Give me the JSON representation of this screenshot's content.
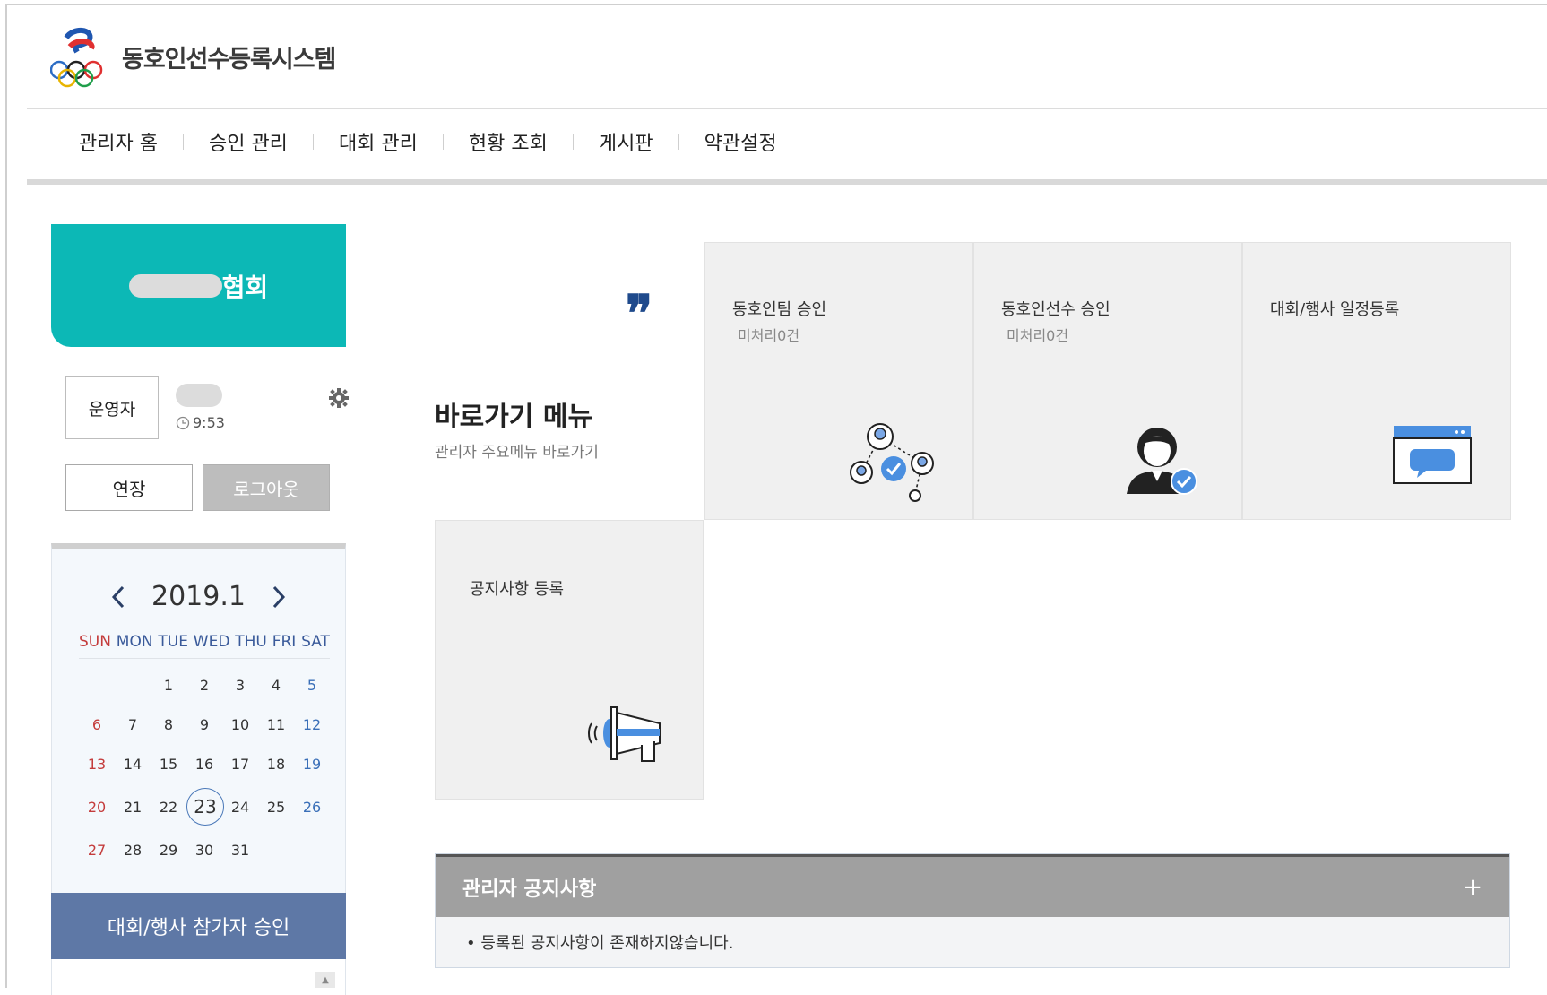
{
  "header": {
    "title": "동호인선수등록시스템"
  },
  "nav": {
    "items": [
      {
        "label": "관리자 홈"
      },
      {
        "label": "승인 관리"
      },
      {
        "label": "대회 관리"
      },
      {
        "label": "현황 조회"
      },
      {
        "label": "게시판"
      },
      {
        "label": "약관설정"
      }
    ]
  },
  "sidebar": {
    "assoc_suffix": "협회",
    "role": "운영자",
    "time": "9:53",
    "extend_label": "연장",
    "logout_label": "로그아웃",
    "calendar": {
      "title": "2019.1",
      "dow": [
        "SUN",
        "MON",
        "TUE",
        "WED",
        "THU",
        "FRI",
        "SAT"
      ],
      "weeks": [
        [
          "",
          "",
          "1",
          "2",
          "3",
          "4",
          "5"
        ],
        [
          "6",
          "7",
          "8",
          "9",
          "10",
          "11",
          "12"
        ],
        [
          "13",
          "14",
          "15",
          "16",
          "17",
          "18",
          "19"
        ],
        [
          "20",
          "21",
          "22",
          "23",
          "24",
          "25",
          "26"
        ],
        [
          "27",
          "28",
          "29",
          "30",
          "31",
          "",
          ""
        ]
      ],
      "today": "23"
    },
    "approve_label": "대회/행사 참가자 승인"
  },
  "shortcuts": {
    "quote": "❞",
    "title": "바로가기 메뉴",
    "subtitle": "관리자 주요메뉴 바로가기",
    "cards": [
      {
        "title": "동호인팀 승인",
        "count": "미처리0건",
        "icon": "network-check-icon"
      },
      {
        "title": "동호인선수 승인",
        "count": "미처리0건",
        "icon": "person-check-icon"
      },
      {
        "title": "대회/행사 일정등록",
        "count": "",
        "icon": "window-chat-icon"
      },
      {
        "title": "공지사항 등록",
        "count": "",
        "icon": "megaphone-icon"
      }
    ]
  },
  "notice": {
    "title": "관리자 공지사항",
    "plus": "+",
    "empty": "• 등록된 공지사항이 존재하지않습니다."
  },
  "colors": {
    "teal": "#0cb8b6",
    "navy": "#5e78a6",
    "icon_blue": "#4a8fe0"
  }
}
